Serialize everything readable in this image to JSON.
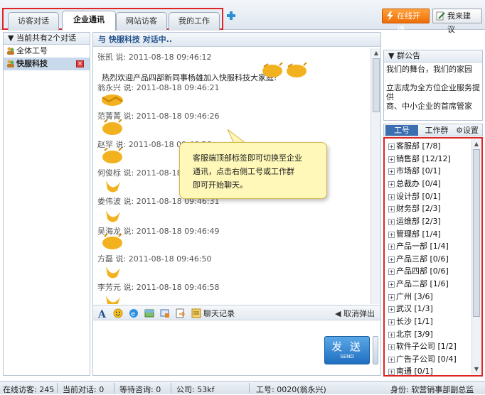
{
  "tabs": [
    "访客对话",
    "企业通讯",
    "网站访客",
    "我的工作"
  ],
  "active_tab": 1,
  "top_buttons": {
    "online": "在线开通",
    "suggest": "我来建议"
  },
  "left_panel": {
    "header": "当前共有2个对话",
    "sessions": [
      {
        "label": "全体工号",
        "selected": false
      },
      {
        "label": "快服科技",
        "selected": true
      }
    ]
  },
  "chat": {
    "header": "与 快服科技 对话中..",
    "messages": [
      {
        "sender": "张凯",
        "said": "说:",
        "time": "2011-08-18 09:46:12",
        "text": "热烈欢迎产品四部新同事杨雄加入快服科技大家庭!"
      },
      {
        "sender": "翁永兴",
        "said": "说:",
        "time": "2011-08-18 09:46:21",
        "text": ""
      },
      {
        "sender": "范菁菁",
        "said": "说:",
        "time": "2011-08-18 09:46:26",
        "text": ""
      },
      {
        "sender": "赵罕",
        "said": "说:",
        "time": "2011-08-18 09:46:26",
        "text": ""
      },
      {
        "sender": "何俊标",
        "said": "说:",
        "time": "2011-08-18 09:46:26",
        "text": ""
      },
      {
        "sender": "娄伟波",
        "said": "说:",
        "time": "2011-08-18 09:46:31",
        "text": ""
      },
      {
        "sender": "吴海龙",
        "said": "说:",
        "time": "2011-08-18 09:46:49",
        "text": ""
      },
      {
        "sender": "方磊",
        "said": "说:",
        "time": "2011-08-18 09:46:50",
        "text": ""
      },
      {
        "sender": "李芳元",
        "said": "说:",
        "time": "2011-08-18 09:46:58",
        "text": ""
      }
    ],
    "tooltip": [
      "客服端顶部标签即可切换至企业",
      "通讯，点击右侧工号或工作群",
      "即可开始聊天。"
    ],
    "toolbar": {
      "history": "聊天记录",
      "cancel_popup": "取消弹出"
    },
    "send": {
      "label": "发 送",
      "sub": "SEND"
    }
  },
  "notice": {
    "header": "群公告",
    "lines": [
      "我们的舞台，我们的家园",
      "",
      "立志成为全方位企业服务提供",
      "商、中小企业的首席管家"
    ]
  },
  "right_tabs": {
    "id": "工号",
    "group": "工作群",
    "settings": "设置"
  },
  "departments": [
    "客服部 [7/8]",
    "销售部 [12/12]",
    "市场部 [0/1]",
    "总裁办 [0/4]",
    "设计部 [0/1]",
    "财务部 [2/3]",
    "运维部 [2/3]",
    "管理部 [1/4]",
    "产品一部 [1/4]",
    "产品三部 [0/6]",
    "产品四部 [0/6]",
    "产品二部 [1/6]",
    "广州 [3/6]",
    "武汉 [1/3]",
    "长沙 [1/1]",
    "北京 [3/9]",
    "软件子公司 [1/2]",
    "广告子公司 [0/4]",
    "南通 [0/1]"
  ],
  "status_bar": {
    "online_visitors": "在线访客: 245",
    "current_sessions": "当前对话: 0",
    "waiting": "等待咨询: 0",
    "company": "公司: 53kf",
    "agent": "工号: 0020(翁永兴)",
    "role": "身份: 软营销事部副总监"
  },
  "colors": {
    "accent": "#1f4f8a",
    "highlight_border": "#e02424",
    "online_button": "#ee6d05",
    "tooltip": "#fff8b8"
  }
}
